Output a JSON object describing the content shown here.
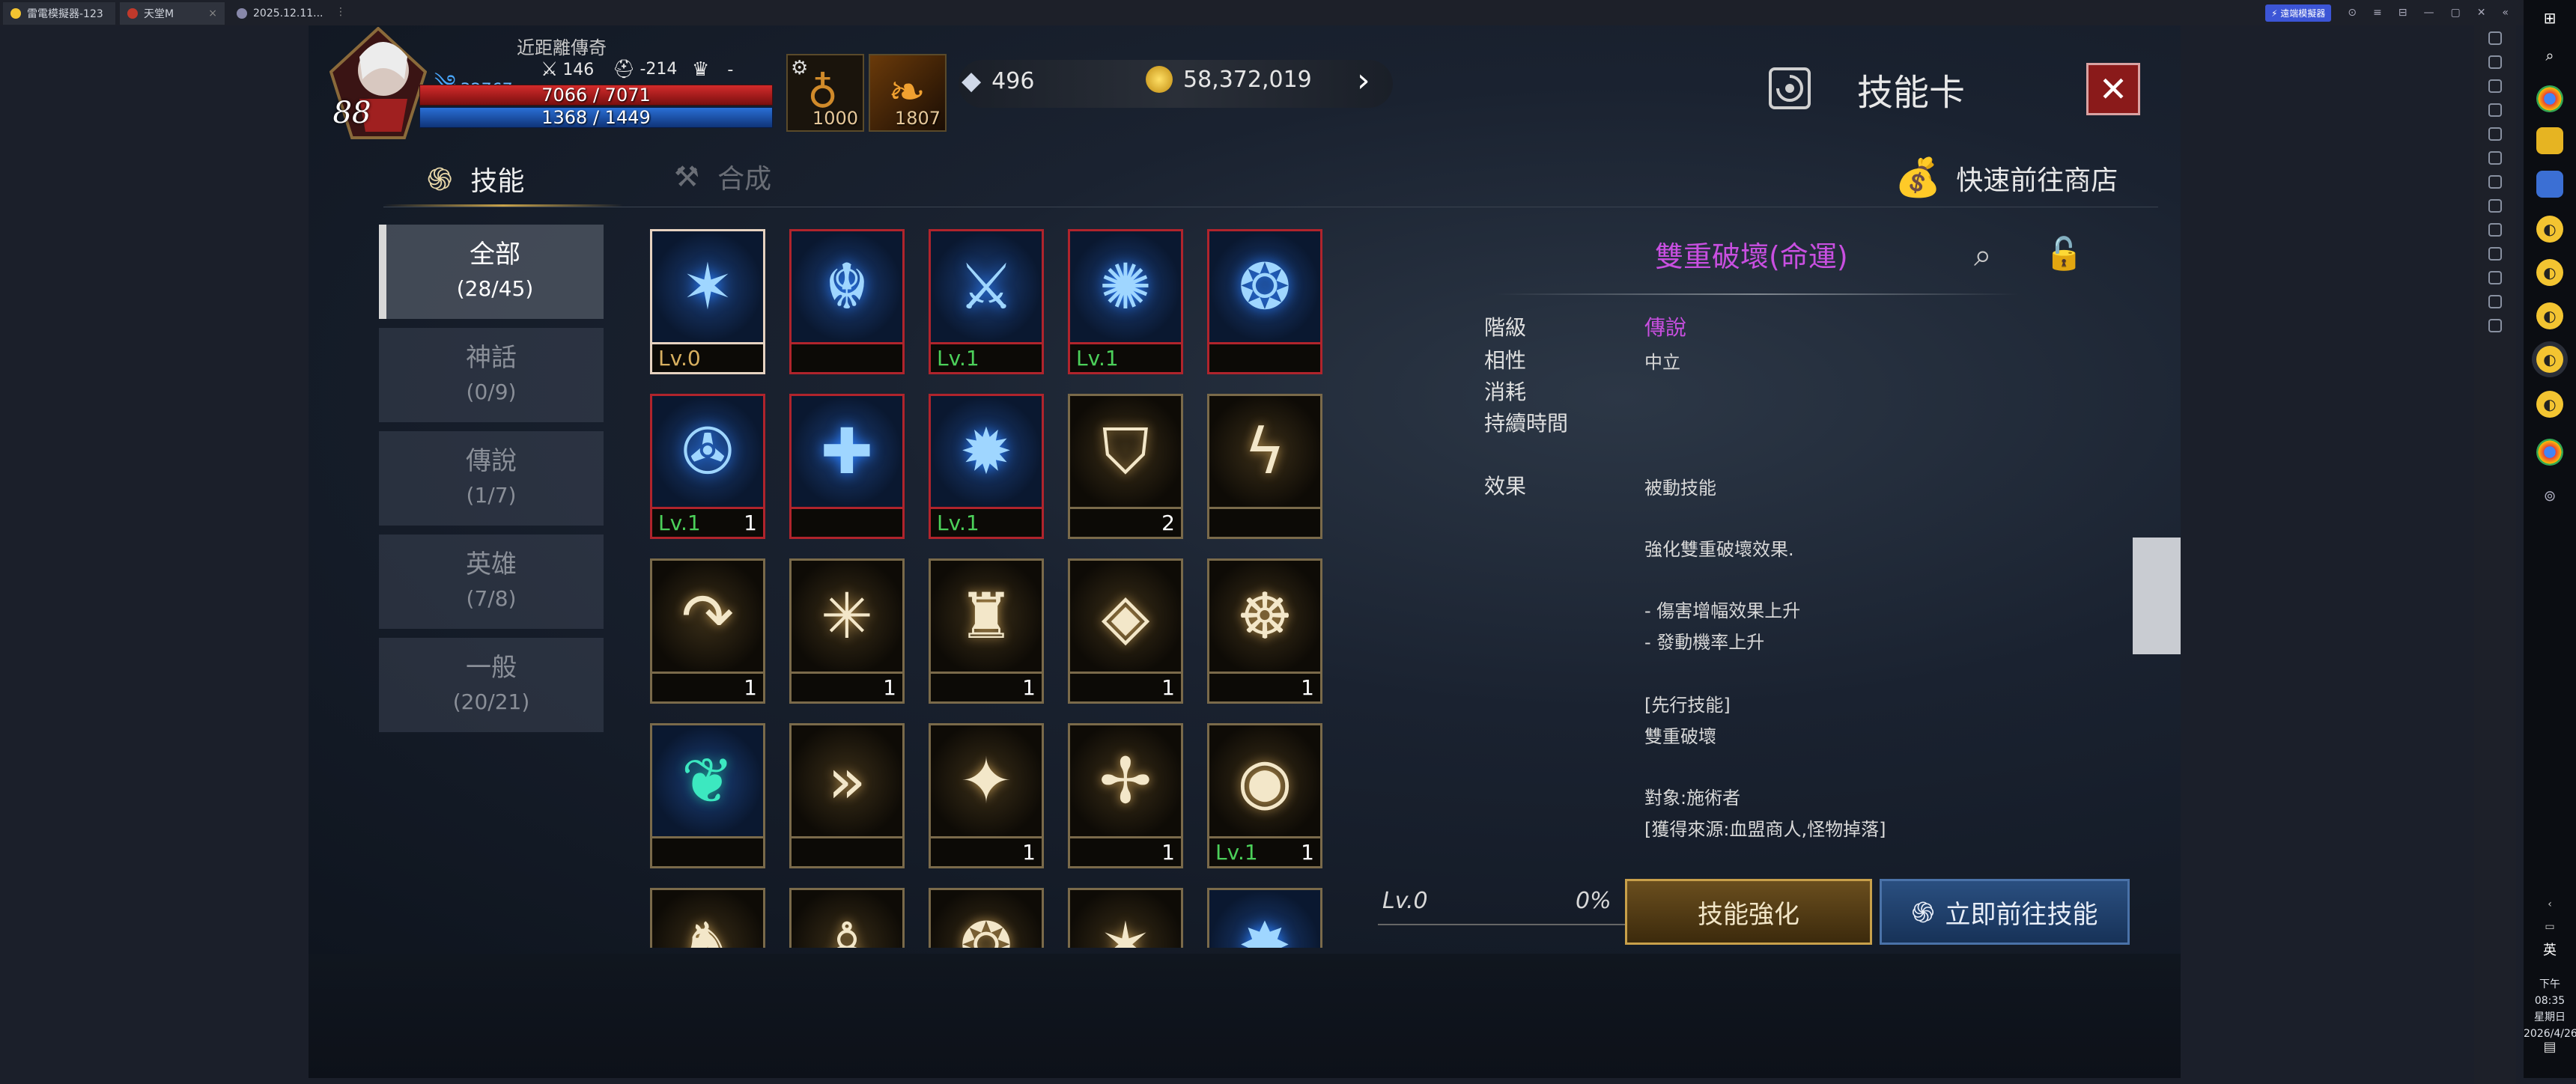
{
  "emulator": {
    "tabs": [
      {
        "label": "雷電模擬器-123",
        "color": "#f3c431"
      },
      {
        "label": "天堂M",
        "color": "#c0392b"
      },
      {
        "label": "2025.12.11...",
        "color": "#8888aa"
      }
    ],
    "cloud_badge": "⚡ 遠端模擬器",
    "controls": [
      "⊙",
      "≡",
      "⊟",
      "—",
      "▢",
      "✕",
      "«"
    ]
  },
  "hud": {
    "level": "88",
    "title": "近距離傳奇",
    "power_value": "32767",
    "attack_value": "146",
    "defense_value": "-214",
    "trophy_value": "-",
    "hp_text": "7066 / 7071",
    "mp_text": "1368 / 1449",
    "hp_fraction": 0.999,
    "mp_fraction": 0.944,
    "potion_count": "1000",
    "item_count": "1807",
    "diamonds": "496",
    "gold": "58,372,019"
  },
  "header": {
    "title": "技能卡",
    "close_label": "✕"
  },
  "tabs": {
    "skills": "技能",
    "synthesis": "合成",
    "shop_link": "快速前往商店"
  },
  "categories": [
    {
      "label": "全部",
      "count": "(28/45)",
      "active": true
    },
    {
      "label": "神話",
      "count": "(0/9)"
    },
    {
      "label": "傳說",
      "count": "(1/7)"
    },
    {
      "label": "英雄",
      "count": "(7/8)"
    },
    {
      "label": "一般",
      "count": "(20/21)"
    }
  ],
  "skills": [
    {
      "icon": "shatter-icon",
      "glyph": "✶",
      "theme": "blue",
      "border": "sel",
      "lv": "Lv.0",
      "qty": ""
    },
    {
      "icon": "demon-mask-icon",
      "glyph": "☬",
      "theme": "blue",
      "border": "red",
      "lv": "",
      "qty": ""
    },
    {
      "icon": "crossed-swords-icon",
      "glyph": "⚔",
      "theme": "blue",
      "border": "red",
      "lv": "Lv.1",
      "qty": ""
    },
    {
      "icon": "vortex-icon",
      "glyph": "✺",
      "theme": "blue",
      "border": "red",
      "lv": "Lv.1",
      "qty": ""
    },
    {
      "icon": "swirl-icon",
      "glyph": "❂",
      "theme": "blue",
      "border": "red",
      "lv": "",
      "qty": ""
    },
    {
      "icon": "pinwheel-icon",
      "glyph": "✇",
      "theme": "blue",
      "border": "red",
      "lv": "Lv.1",
      "qty": "1"
    },
    {
      "icon": "plus-cross-icon",
      "glyph": "✚",
      "theme": "blue",
      "border": "red",
      "lv": "",
      "qty": ""
    },
    {
      "icon": "burst-orb-icon",
      "glyph": "✹",
      "theme": "blue",
      "border": "red",
      "lv": "Lv.1",
      "qty": ""
    },
    {
      "icon": "shield-icon",
      "glyph": "⛉",
      "theme": "gold",
      "border": "gold",
      "lv": "",
      "qty": "2"
    },
    {
      "icon": "lightning-icon",
      "glyph": "ϟ",
      "theme": "gold",
      "border": "gold",
      "lv": "",
      "qty": ""
    },
    {
      "icon": "curved-arrow-icon",
      "glyph": "↷",
      "theme": "gold",
      "border": "gold",
      "lv": "",
      "qty": "1"
    },
    {
      "icon": "spark-icon",
      "glyph": "✳",
      "theme": "gold",
      "border": "gold",
      "lv": "",
      "qty": "1"
    },
    {
      "icon": "altar-icon",
      "glyph": "♜",
      "theme": "gold",
      "border": "gold",
      "lv": "",
      "qty": "1"
    },
    {
      "icon": "eye-icon",
      "glyph": "◈",
      "theme": "gold",
      "border": "gold",
      "lv": "",
      "qty": "1"
    },
    {
      "icon": "sun-rune-icon",
      "glyph": "☸",
      "theme": "gold",
      "border": "gold",
      "lv": "",
      "qty": "1"
    },
    {
      "icon": "leaf-icon",
      "glyph": "❦",
      "theme": "teal",
      "border": "gold",
      "lv": "",
      "qty": ""
    },
    {
      "icon": "chevrons-icon",
      "glyph": "»",
      "theme": "gold",
      "border": "gold",
      "lv": "",
      "qty": ""
    },
    {
      "icon": "sparkle-icon",
      "glyph": "✦",
      "theme": "gold",
      "border": "gold",
      "lv": "",
      "qty": "1"
    },
    {
      "icon": "shuriken-icon",
      "glyph": "✢",
      "theme": "gold",
      "border": "gold",
      "lv": "",
      "qty": "1"
    },
    {
      "icon": "watching-eye-icon",
      "glyph": "◉",
      "theme": "gold",
      "border": "gold",
      "lv": "Lv.1",
      "qty": "1"
    },
    {
      "icon": "beast-icon",
      "glyph": "♞",
      "theme": "gold",
      "border": "gold",
      "lv": "",
      "qty": ""
    },
    {
      "icon": "figure-icon",
      "glyph": "♙",
      "theme": "gold",
      "border": "gold",
      "lv": "",
      "qty": ""
    },
    {
      "icon": "rings-icon",
      "glyph": "❂",
      "theme": "gold",
      "border": "gold",
      "lv": "",
      "qty": ""
    },
    {
      "icon": "shatter-gold-icon",
      "glyph": "✶",
      "theme": "gold",
      "border": "gold",
      "lv": "",
      "qty": ""
    },
    {
      "icon": "ice-burst-icon",
      "glyph": "✸",
      "theme": "blue",
      "border": "gold",
      "lv": "",
      "qty": ""
    }
  ],
  "detail": {
    "name": "雙重破壞(命運)",
    "rows": [
      {
        "label": "階級",
        "value": "傳說"
      },
      {
        "label": "相性",
        "value": "中立"
      },
      {
        "label": "消耗",
        "value": ""
      },
      {
        "label": "持續時間",
        "value": ""
      }
    ],
    "effect_label": "效果",
    "effect_lines": [
      "被動技能",
      "強化雙重破壞效果.",
      "- 傷害增幅效果上升",
      "- 發動機率上升",
      "[先行技能]",
      "雙重破壞",
      "對象:施術者",
      "[獲得來源:血盟商人,怪物掉落]"
    ],
    "exp_level": "Lv.0",
    "exp_percent": "0%",
    "enhance_label": "技能強化",
    "goto_label": "立即前往技能"
  },
  "taskbar": {
    "time": "下午 08:35",
    "weekday": "星期日",
    "date": "2026/4/26",
    "ime": "英"
  }
}
